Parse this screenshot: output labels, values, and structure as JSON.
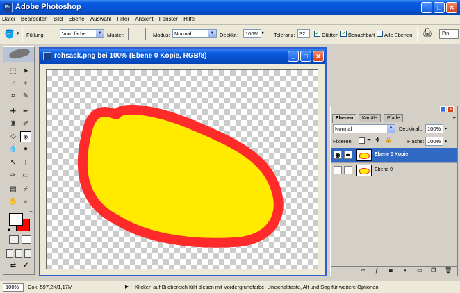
{
  "app": {
    "title": "Adobe Photoshop"
  },
  "colors": {
    "accent": "#0a5ae0",
    "fill_yellow": "#ffea00",
    "stroke_red": "#ff2a2a",
    "selection": "#316ac5"
  },
  "menu": [
    "Datei",
    "Bearbeiten",
    "Bild",
    "Ebene",
    "Auswahl",
    "Filter",
    "Ansicht",
    "Fenster",
    "Hilfe"
  ],
  "options": {
    "fill_label": "Füllung:",
    "fill_value": "Vord.farbe",
    "pattern_label": "Muster:",
    "mode_label": "Modus:",
    "mode_value": "Normal",
    "opacity_label": "Deckkr.:",
    "opacity_value": "100%",
    "tolerance_label": "Toleranz:",
    "tolerance_value": "32",
    "smooth_label": "Glätten",
    "contiguous_label": "Benachbart",
    "all_layers_label": "Alle Ebenen",
    "palette_label": "Pin"
  },
  "document": {
    "title": "rohsack.png bei 100% (Ebene 0 Kopie, RGB/8)"
  },
  "layers_panel": {
    "tabs": [
      "Ebenen",
      "Kanäle",
      "Pfade"
    ],
    "blend_mode": "Normal",
    "opacity_label": "Deckkraft:",
    "opacity_value": "100%",
    "lock_label": "Fixieren:",
    "fill_label": "Fläche:",
    "fill_value": "100%",
    "layers": [
      {
        "name": "Ebene 0 Kopie",
        "selected": true,
        "visible": true
      },
      {
        "name": "Ebene 0",
        "selected": false,
        "visible": false
      }
    ]
  },
  "status": {
    "zoom": "100%",
    "doc_size": "Dok: 597,2K/1,17M",
    "hint": "Klicken auf Bildbereich füllt diesen mit Vordergrundfarbe. Umschalttaste, Alt und Strg für weitere Optionen."
  },
  "icons": {
    "paint_bucket": "paint-bucket-icon",
    "eye": "eye-icon",
    "brush": "brush-icon"
  }
}
